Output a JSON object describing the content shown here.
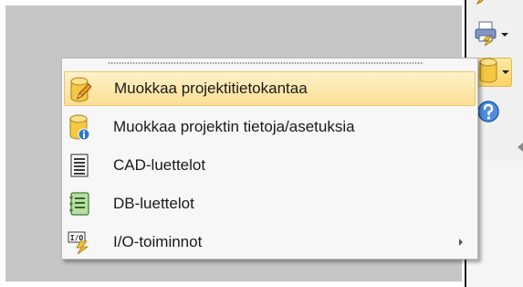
{
  "toolbar": {
    "buttons": [
      {
        "icon": "edit-pencil-icon"
      },
      {
        "icon": "print-icon"
      },
      {
        "icon": "database-icon"
      },
      {
        "icon": "help-icon"
      }
    ]
  },
  "menu": {
    "items": [
      {
        "label": "Muokkaa projektitietokantaa",
        "icon": "database-edit-icon",
        "highlighted": true
      },
      {
        "label": "Muokkaa projektin tietoja/asetuksia",
        "icon": "database-info-icon"
      },
      {
        "label": "CAD-luettelot",
        "icon": "list-document-icon"
      },
      {
        "label": "DB-luettelot",
        "icon": "db-list-icon"
      },
      {
        "label": "I/O-toiminnot",
        "icon": "io-icon",
        "has_submenu": true
      }
    ]
  },
  "colors": {
    "highlight": "#fcdf94",
    "highlight_border": "#e8c56a",
    "canvas": "#c6c6c6",
    "menu_bg": "#f7f7f7"
  }
}
